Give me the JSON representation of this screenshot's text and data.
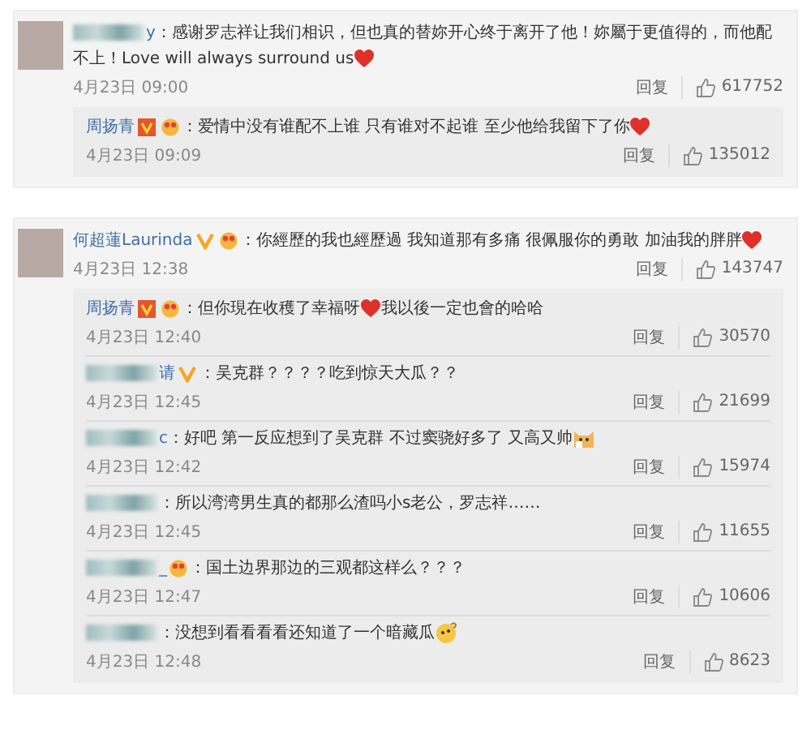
{
  "threads": [
    {
      "name_blurred": true,
      "name": "y",
      "text": "：感谢罗志祥让我们相识，但也真的替妳开心终于离开了他！妳屬于更值得的，而他配不上！Love will always surround us",
      "end_icon": {
        "kind": "heart"
      },
      "date": "4月23日 09:00",
      "reply_label": "回复",
      "likes": "617752",
      "replies": [
        {
          "name_blurred": false,
          "name": "周扬青",
          "badges": [
            {
              "kind": "v-square"
            },
            {
              "kind": "emoji"
            }
          ],
          "text": "：爱情中没有谁配不上谁 只有谁对不起谁 至少他给我留下了你",
          "end_icon": {
            "kind": "heart"
          },
          "date": "4月23日 09:09",
          "reply_label": "回复",
          "likes": "135012"
        }
      ]
    },
    {
      "name_blurred": false,
      "name": "何超蓮Laurinda",
      "badges": [
        {
          "kind": "v-plain"
        },
        {
          "kind": "emoji"
        }
      ],
      "text": "：你經歷的我也經歷過 我知道那有多痛 很佩服你的勇敢 加油我的胖胖",
      "end_icon": {
        "kind": "heart"
      },
      "date": "4月23日 12:38",
      "reply_label": "回复",
      "likes": "143747",
      "replies": [
        {
          "name_blurred": false,
          "name": "周扬青",
          "badges": [
            {
              "kind": "v-square"
            },
            {
              "kind": "emoji"
            }
          ],
          "text": "：但你現在收穫了幸福呀",
          "end_icon": {
            "kind": "heart"
          },
          "after": "我以後一定也會的哈哈",
          "date": "4月23日 12:40",
          "reply_label": "回复",
          "likes": "30570"
        },
        {
          "name_blurred": true,
          "name": "请",
          "badges": [
            {
              "kind": "v-plain"
            }
          ],
          "text": "：吴克群？？？？吃到惊天大瓜？？",
          "date": "4月23日 12:45",
          "reply_label": "回复",
          "likes": "21699"
        },
        {
          "name_blurred": true,
          "name": "c",
          "text": "：好吧 第一反应想到了吴克群 不过窦骁好多了 又高又帅",
          "end_icon": {
            "kind": "cat"
          },
          "date": "4月23日 12:42",
          "reply_label": "回复",
          "likes": "15974"
        },
        {
          "name_blurred": true,
          "text": "：所以湾湾男生真的都那么渣吗小s老公，罗志祥……",
          "date": "4月23日 12:45",
          "reply_label": "回复",
          "likes": "11655"
        },
        {
          "name_blurred": true,
          "name": "_",
          "badges": [
            {
              "kind": "emoji"
            }
          ],
          "text": "：国土边界那边的三观都这样么？？？",
          "date": "4月23日 12:47",
          "reply_label": "回复",
          "likes": "10606"
        },
        {
          "name_blurred": true,
          "text": "：没想到看看看看还知道了一个暗藏瓜",
          "end_icon": {
            "kind": "thinking"
          },
          "date": "4月23日 12:48",
          "reply_label": "回复",
          "likes": "8623"
        }
      ]
    }
  ]
}
